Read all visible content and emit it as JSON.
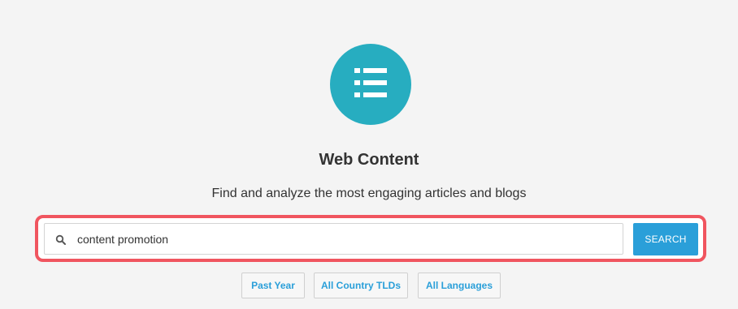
{
  "header": {
    "logo_icon": "list-icon",
    "logo_color": "#27adc0",
    "title": "Web Content",
    "subtitle": "Find and analyze the most engaging articles and blogs"
  },
  "search": {
    "icon": "search-icon",
    "value": "content promotion",
    "button_label": "SEARCH",
    "button_color": "#2a9fd9",
    "highlight_color": "#f0555f"
  },
  "filters": [
    {
      "label": "Past Year"
    },
    {
      "label": "All Country TLDs"
    },
    {
      "label": "All Languages"
    }
  ]
}
